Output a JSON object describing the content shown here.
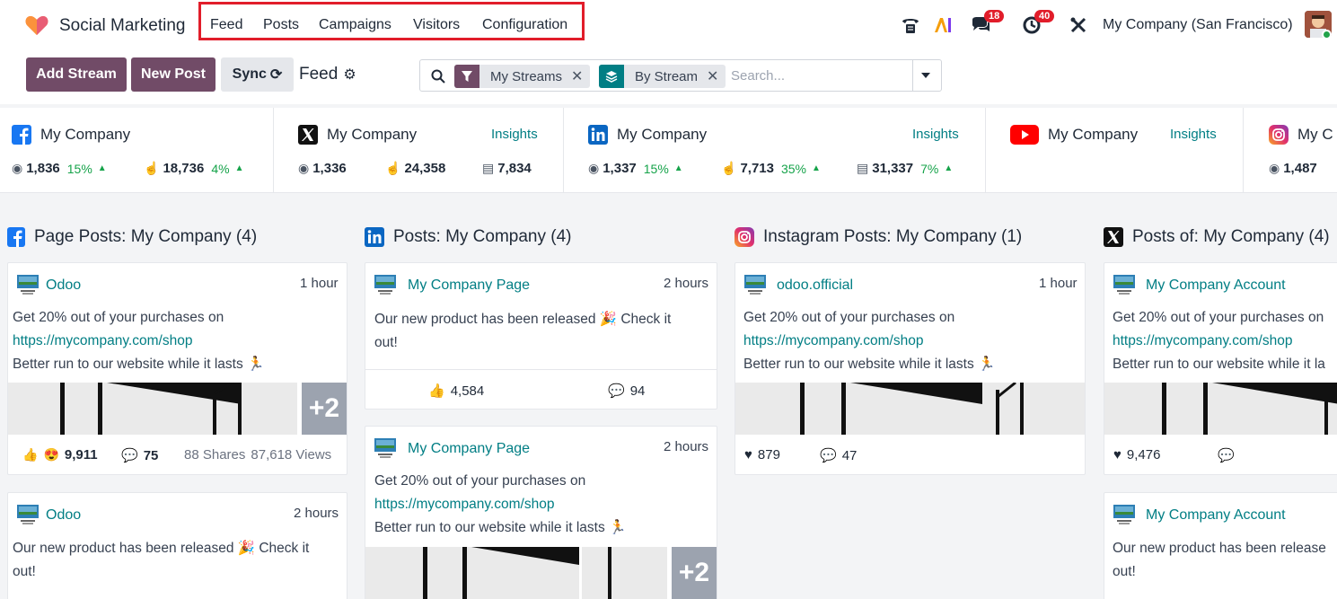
{
  "topbar": {
    "app_name": "Social Marketing",
    "menu": [
      "Feed",
      "Posts",
      "Campaigns",
      "Visitors",
      "Configuration"
    ],
    "badges": {
      "chat": "18",
      "activity": "40"
    },
    "company": "My Company (San Francisco)"
  },
  "controls": {
    "add_stream": "Add Stream",
    "new_post": "New Post",
    "sync": "Sync",
    "feed_title": "Feed",
    "facet1": "My Streams",
    "facet2": "By Stream",
    "search_placeholder": "Search..."
  },
  "stats": {
    "fb": {
      "name": "My Company",
      "followers": "1,836",
      "followers_pct": "15%",
      "engagement": "18,736",
      "engagement_pct": "4%"
    },
    "x": {
      "name": "My Company",
      "insights": "Insights",
      "followers": "1,336",
      "engagement": "24,358",
      "stories": "7,834"
    },
    "li": {
      "name": "My Company",
      "insights": "Insights",
      "followers": "1,337",
      "followers_pct": "15%",
      "engagement": "7,713",
      "engagement_pct": "35%",
      "stories": "31,337",
      "stories_pct": "7%"
    },
    "yt": {
      "name": "My Company",
      "insights": "Insights"
    },
    "ig": {
      "name": "My C",
      "followers": "1,487"
    }
  },
  "columns": {
    "fb_title": "Page Posts: My Company (4)",
    "li_title": "Posts: My Company (4)",
    "ig_title": "Instagram Posts: My Company (1)",
    "x_title": "Posts of: My Company (4)"
  },
  "posts": {
    "fb1": {
      "author": "Odoo",
      "time": "1 hour",
      "line1": "Get 20% out of your purchases on",
      "link": "https://mycompany.com/shop",
      "line3": "Better run to our website while it lasts 🏃",
      "likes": "9,911",
      "comments": "75",
      "shares": "88 Shares",
      "views": "87,618 Views",
      "more": "+2"
    },
    "fb2": {
      "author": "Odoo",
      "time": "2 hours",
      "line1": "Our new product has been released 🎉 Check it",
      "line2": "out!"
    },
    "li1": {
      "author": "My Company Page",
      "time": "2 hours",
      "line1": "Our new product has been released 🎉 Check it",
      "line2": "out!",
      "likes": "4,584",
      "comments": "94"
    },
    "li2": {
      "author": "My Company Page",
      "time": "2 hours",
      "line1": "Get 20% out of your purchases on",
      "link": "https://mycompany.com/shop",
      "line3": "Better run to our website while it lasts 🏃",
      "more": "+2"
    },
    "ig1": {
      "author": "odoo.official",
      "time": "1 hour",
      "line1": "Get 20% out of your purchases on",
      "link": "https://mycompany.com/shop",
      "line3": "Better run to our website while it lasts 🏃",
      "likes": "879",
      "comments": "47"
    },
    "x1": {
      "author": "My Company Account",
      "line1": "Get 20% out of your purchases on",
      "link": "https://mycompany.com/shop",
      "line3": "Better run to our website while it la",
      "likes": "9,476"
    },
    "x2": {
      "author": "My Company Account",
      "line1": "Our new product has been release",
      "line2": "out!"
    }
  },
  "colors": {
    "primary": "#714b67",
    "link": "#017e84",
    "positive": "#16a34a",
    "badge": "#e11d2a",
    "highlight": "#e11d2a"
  }
}
